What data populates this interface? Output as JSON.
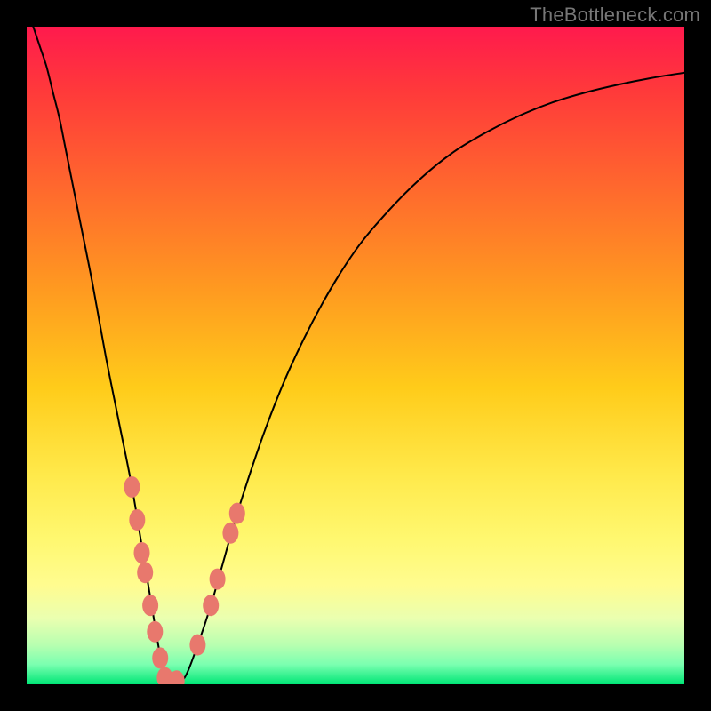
{
  "watermark": "TheBottleneck.com",
  "colors": {
    "curve_stroke": "#000000",
    "marker_fill": "#e8786d",
    "marker_stroke": "#e8786d"
  },
  "chart_data": {
    "type": "line",
    "title": "",
    "xlabel": "",
    "ylabel": "",
    "xlim": [
      0,
      100
    ],
    "ylim": [
      0,
      100
    ],
    "grid": false,
    "legend": false,
    "series": [
      {
        "name": "bottleneck-curve",
        "x": [
          1,
          2,
          3,
          4,
          5,
          6,
          8,
          10,
          12,
          14,
          16,
          18,
          19,
          20,
          21,
          22,
          24,
          26,
          28,
          30,
          32,
          36,
          40,
          45,
          50,
          55,
          60,
          65,
          70,
          75,
          80,
          85,
          90,
          95,
          100
        ],
        "y": [
          100,
          97,
          94,
          90,
          86,
          81,
          71,
          61,
          50,
          40,
          30,
          18,
          12,
          6,
          1,
          0,
          1,
          6,
          12,
          19,
          26,
          38,
          48,
          58,
          66,
          72,
          77,
          81,
          84,
          86.5,
          88.5,
          90,
          91.2,
          92.2,
          93
        ]
      }
    ],
    "markers": [
      {
        "x": 16.0,
        "y": 30
      },
      {
        "x": 16.8,
        "y": 25
      },
      {
        "x": 17.5,
        "y": 20
      },
      {
        "x": 18.0,
        "y": 17
      },
      {
        "x": 18.8,
        "y": 12
      },
      {
        "x": 19.5,
        "y": 8
      },
      {
        "x": 20.3,
        "y": 4
      },
      {
        "x": 21.0,
        "y": 1
      },
      {
        "x": 22.0,
        "y": 0
      },
      {
        "x": 22.8,
        "y": 0.5
      },
      {
        "x": 26.0,
        "y": 6
      },
      {
        "x": 28.0,
        "y": 12
      },
      {
        "x": 29.0,
        "y": 16
      },
      {
        "x": 31.0,
        "y": 23
      },
      {
        "x": 32.0,
        "y": 26
      }
    ]
  }
}
